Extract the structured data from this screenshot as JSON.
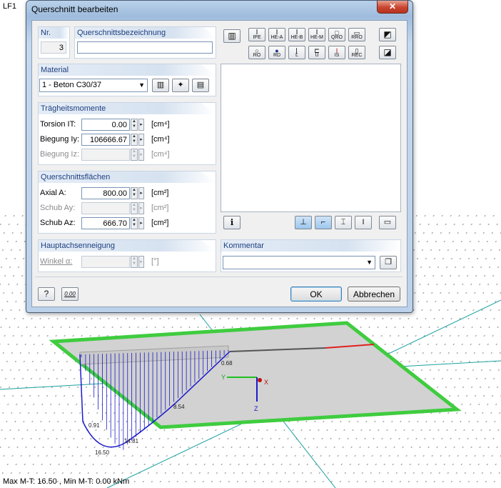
{
  "scene": {
    "load_case": "LF1",
    "status_text": "Max M-T: 16.50 , Min M-T: 0.00 kNm",
    "values": [
      "0.68",
      "8.54",
      "0.91",
      "14.81",
      "16.50"
    ],
    "axis_x": "X",
    "axis_y": "Y",
    "axis_z": "Z"
  },
  "dialog": {
    "title": "Querschnitt bearbeiten",
    "close_glyph": "✕",
    "nr": {
      "label": "Nr.",
      "value": "3"
    },
    "name": {
      "label": "Querschnittsbezeichnung",
      "value": ""
    },
    "material": {
      "label": "Material",
      "selected": "1 - Beton C30/37"
    },
    "inertia": {
      "label": "Trägheitsmomente",
      "rows": [
        {
          "label": "Torsion IT:",
          "value": "0.00",
          "unit": "[cm⁴]"
        },
        {
          "label": "Biegung Iy:",
          "value": "106666.67",
          "unit": "[cm⁴]"
        },
        {
          "label": "Biegung Iz:",
          "value": "",
          "unit": "[cm⁴]"
        }
      ]
    },
    "areas": {
      "label": "Querschnittsflächen",
      "rows": [
        {
          "label": "Axial A:",
          "value": "800.00",
          "unit": "[cm²]"
        },
        {
          "label": "Schub Ay:",
          "value": "",
          "unit": "[cm²]"
        },
        {
          "label": "Schub Az:",
          "value": "666.70",
          "unit": "[cm²]"
        }
      ]
    },
    "principal": {
      "label": "Hauptachsenneigung",
      "angle_label": "Winkel α:",
      "unit": "[°]"
    },
    "comment": {
      "label": "Kommentar",
      "value": ""
    },
    "section_buttons_row1": [
      "IPE",
      "HE-A",
      "HE-B",
      "HE-M",
      "QRO",
      "RRO"
    ],
    "section_buttons_row2": [
      "RO",
      "RD",
      "L",
      "U",
      "IS",
      "REC"
    ],
    "ok_label": "OK",
    "cancel_label": "Abbrechen",
    "calc_label": "0.00"
  },
  "colors": {
    "accent_header": "#1e3f80",
    "plate_border": "#3fcc3f",
    "diagram": "#1a1acc",
    "axis": "#1aa0a0"
  }
}
